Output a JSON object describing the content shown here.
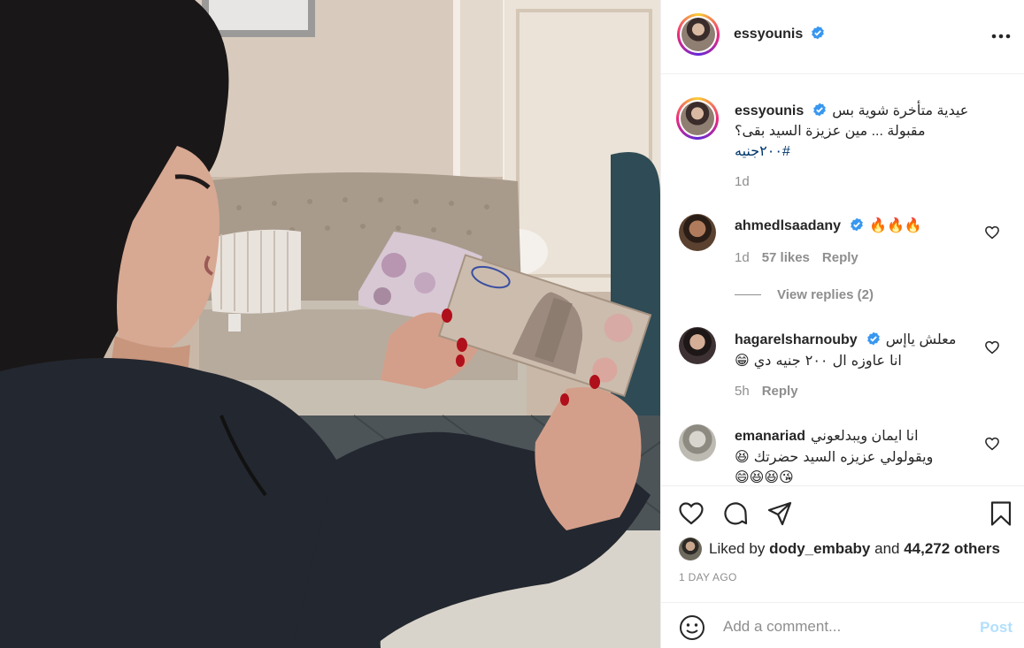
{
  "post": {
    "author": "essyounis",
    "verified": true,
    "caption_line1": "عيدية متأخرة شوية بس",
    "caption_line2": "مقبولة ... مين عزيزة السيد بقى؟",
    "hashtag": "#٢٠٠جنيه",
    "caption_age": "1d",
    "likes_text_prefix": "Liked by",
    "likes_user": "dody_embaby",
    "likes_and": "and",
    "likes_count": "44,272 others",
    "date": "1 DAY AGO"
  },
  "comments": [
    {
      "user": "ahmedlsaadany",
      "verified": true,
      "text": "🔥🔥🔥",
      "age": "1d",
      "likes": "57 likes",
      "reply_label": "Reply",
      "view_replies": "View replies (2)"
    },
    {
      "user": "hagarelsharnouby",
      "verified": true,
      "text_line1": "معلش ياإس",
      "text_line2": "انا عاوزه ال ٢٠٠ جنيه دي 😁",
      "age": "5h",
      "reply_label": "Reply"
    },
    {
      "user": "emanariad",
      "verified": false,
      "text_line1": "انا ايمان ويبدلعوني",
      "text_line2": "ويقولولي عزيزه السيد حضرتك 😆",
      "text_line3": "😄😆😆😘"
    }
  ],
  "add_comment": {
    "placeholder": "Add a comment...",
    "post_label": "Post"
  },
  "icons": {
    "verified": "verified-badge-icon",
    "more": "more-options-icon",
    "like": "heart-icon",
    "comment": "comment-icon",
    "share": "send-icon",
    "save": "bookmark-icon",
    "emoji": "emoji-icon"
  },
  "colors": {
    "verified_blue": "#3897f0",
    "link_blue": "#00376b",
    "muted": "#8e8e8e",
    "post_button_disabled": "#b2dffc"
  }
}
